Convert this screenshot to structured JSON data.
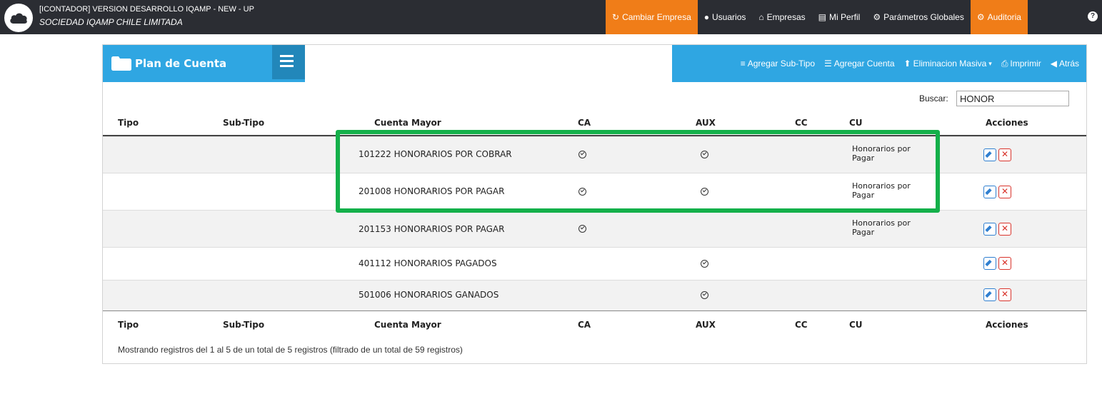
{
  "header": {
    "app_title": "[ICONTADOR] VERSION DESARROLLO IQAMP - NEW - UP",
    "company": "SOCIEDAD IQAMP CHILE LIMITADA",
    "nav": [
      {
        "label": "Cambiar Empresa",
        "icon": "refresh-icon",
        "accent": "#f07d18"
      },
      {
        "label": "Usuarios",
        "icon": "user-icon"
      },
      {
        "label": "Empresas",
        "icon": "home-icon"
      },
      {
        "label": "Mi Perfil",
        "icon": "folder-open-icon"
      },
      {
        "label": "Parámetros Globales",
        "icon": "gear-icon"
      },
      {
        "label": "Auditoria",
        "icon": "gears-icon",
        "accent": "#f07d18"
      }
    ],
    "help_icon": "question-icon"
  },
  "panel": {
    "title": "Plan de Cuenta",
    "actions": [
      {
        "label": "Agregar Sub-Tipo",
        "icon": "stack-icon"
      },
      {
        "label": "Agregar Cuenta",
        "icon": "list-icon"
      },
      {
        "label": "Eliminacion Masiva",
        "icon": "upload-icon",
        "dropdown": true
      },
      {
        "label": "Imprimir",
        "icon": "print-icon"
      },
      {
        "label": "Atrás",
        "icon": "back-icon"
      }
    ],
    "accent_color": "#2fa6e2"
  },
  "search": {
    "label": "Buscar:",
    "value": "HONOR"
  },
  "table": {
    "columns": [
      "Tipo",
      "Sub-Tipo",
      "Cuenta Mayor",
      "CA",
      "AUX",
      "CC",
      "CU",
      "Acciones"
    ],
    "rows": [
      {
        "tipo": "",
        "subtipo": "",
        "cuenta": "101222 HONORARIOS POR COBRAR",
        "ca": true,
        "aux": true,
        "cc": false,
        "cu": "Honorarios por Pagar"
      },
      {
        "tipo": "",
        "subtipo": "",
        "cuenta": "201008 HONORARIOS POR PAGAR",
        "ca": true,
        "aux": true,
        "cc": false,
        "cu": "Honorarios por Pagar"
      },
      {
        "tipo": "",
        "subtipo": "",
        "cuenta": "201153 HONORARIOS POR PAGAR",
        "ca": true,
        "aux": false,
        "cc": false,
        "cu": "Honorarios por Pagar"
      },
      {
        "tipo": "",
        "subtipo": "",
        "cuenta": "401112 HONORARIOS PAGADOS",
        "ca": false,
        "aux": true,
        "cc": false,
        "cu": ""
      },
      {
        "tipo": "",
        "subtipo": "",
        "cuenta": "501006 HONORARIOS GANADOS",
        "ca": false,
        "aux": true,
        "cc": false,
        "cu": ""
      }
    ],
    "info": "Mostrando registros del 1 al 5 de un total de 5 registros (filtrado de un total de 59 registros)"
  },
  "highlight_color": "#14b04a"
}
